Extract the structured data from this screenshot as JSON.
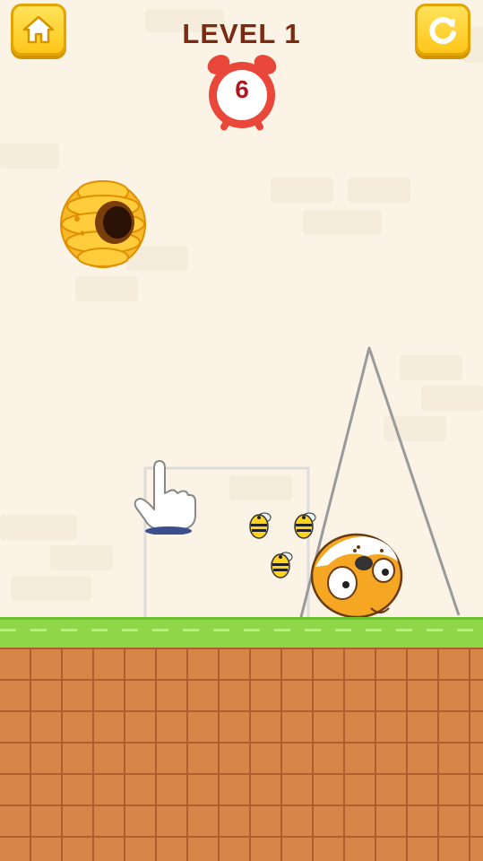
{
  "hud": {
    "level_label": "LEVEL 1",
    "timer": "6",
    "home_icon": "home-icon",
    "restart_icon": "restart-icon"
  },
  "colors": {
    "background": "#fbf3e6",
    "title": "#7a2b12",
    "hud_button": "#ffc61a",
    "clock": "#e8473a",
    "grass": "#8fd648",
    "dirt": "#d7864a",
    "hive": "#f5b92a",
    "dog": "#f5a623"
  },
  "scene": {
    "characters": [
      "beehive",
      "bees",
      "dog"
    ],
    "hint": "hand-pointer-icon",
    "bee_count": 3
  }
}
